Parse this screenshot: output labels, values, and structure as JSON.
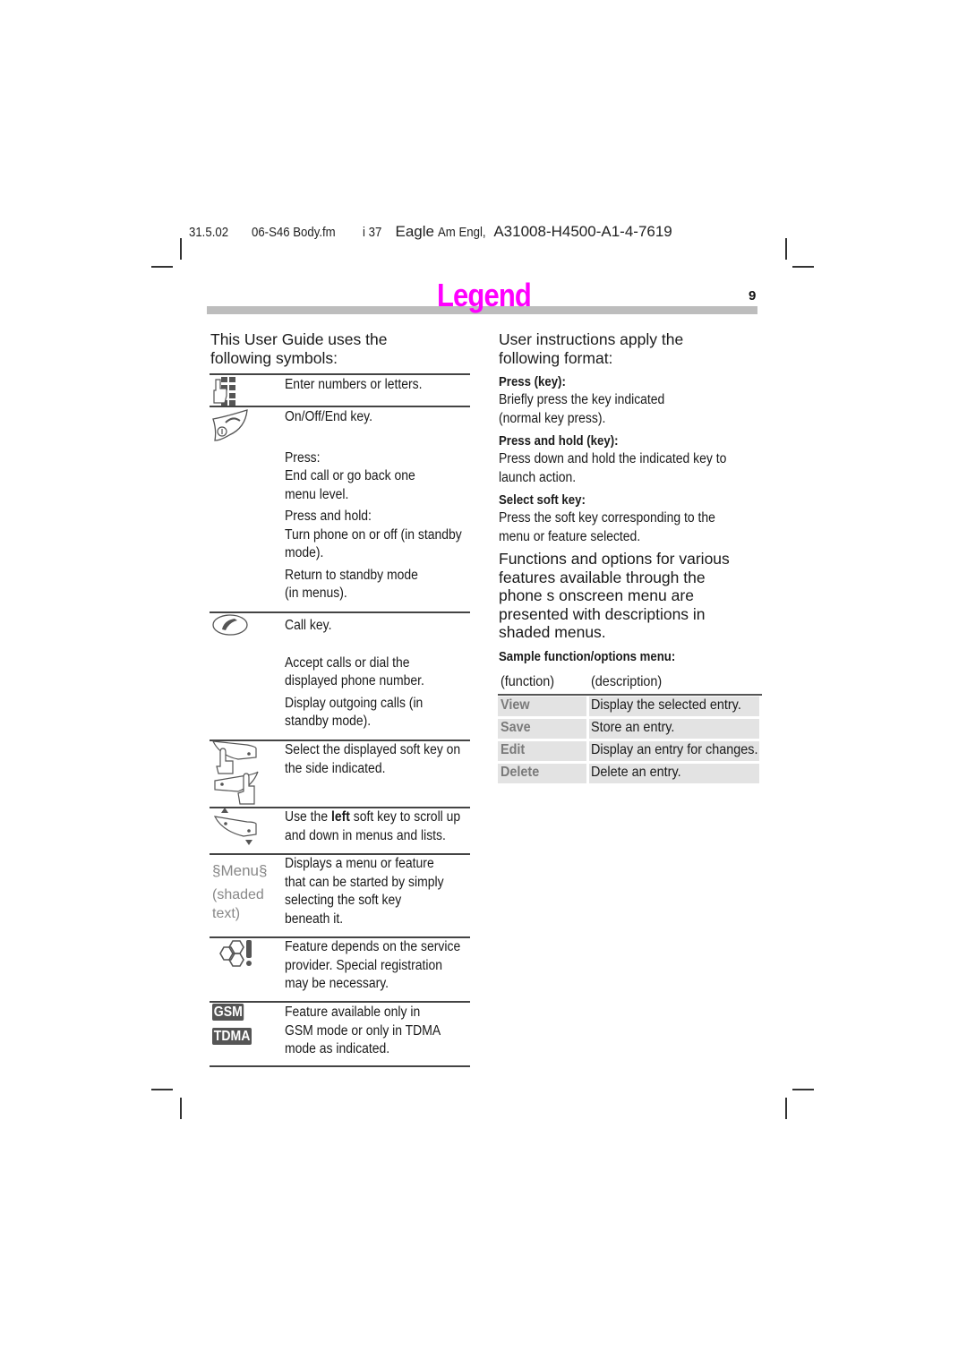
{
  "header": {
    "date": "31.5.02",
    "file": "06-S46 Body.fm",
    "page_ref": "i 37",
    "doc_name": "Eagle",
    "doc_lang": "Am Engl,",
    "doc_code": "A31008-H4500-A1-4-7619"
  },
  "page": {
    "title": "Legend",
    "number": "9",
    "title_color": "#ff00ff"
  },
  "left": {
    "intro_line1": "This User Guide uses the",
    "intro_line2": "following symbols:",
    "symbols": [
      {
        "icon": "keypad-hand-icon",
        "lines": [
          "Enter numbers or letters."
        ]
      },
      {
        "icon": "on-off-end-key-icon",
        "lines": [
          "On/Off/End key.",
          "",
          "Press:",
          "End call or go back one",
          "menu level.",
          "Press and hold:",
          "Turn phone on or off (in standby",
          "mode).",
          "Return to standby mode",
          "(in menus)."
        ]
      },
      {
        "icon": "call-key-icon",
        "lines": [
          "Call key.",
          "",
          "Accept calls or dial the",
          "displayed phone number.",
          "Display outgoing calls (in",
          "standby mode)."
        ]
      },
      {
        "icon": "soft-key-hand-icon",
        "lines": [
          "Select the displayed soft key on",
          "the side indicated."
        ]
      },
      {
        "icon": "soft-key-scroll-icon",
        "lines_pre": "Use the ",
        "bold": "left",
        "lines_post": " soft key to scroll up",
        "line2": "and down in menus and lists."
      },
      {
        "icon": "menu-shaded-text",
        "label": "§Menu§",
        "label2": "(shaded",
        "label3": "text)",
        "lines": [
          "Displays a menu or feature",
          "that can be started by simply",
          "selecting the soft key",
          "beneath it."
        ]
      },
      {
        "icon": "service-provider-icon",
        "lines": [
          "Feature depends on the service",
          "provider. Special registration",
          "may be necessary."
        ]
      },
      {
        "icon": "gsm-tdma-badge",
        "badge1": "GSM",
        "badge2": "TDMA",
        "lines": [
          "Feature available only in",
          "GSM mode or only in TDMA",
          "mode as indicated."
        ]
      }
    ]
  },
  "right": {
    "intro_line1": "User instructions apply the",
    "intro_line2": "following format:",
    "formats": [
      {
        "heading": "Press (key):",
        "lines": [
          "Briefly press the key indicated",
          "(normal key press)."
        ]
      },
      {
        "heading": "Press and hold (key):",
        "lines": [
          "Press down and hold the indicated key to",
          "launch action."
        ]
      },
      {
        "heading": "Select soft key:",
        "lines": [
          "Press the soft key corresponding to the",
          "menu or feature selected."
        ]
      }
    ],
    "functions_para": [
      "Functions and options for various",
      "features available through the",
      "phone s onscreen menu are",
      "presented with descriptions in",
      "shaded menus."
    ],
    "sample_heading": "Sample function/options menu:",
    "menu": {
      "col_function": "(function)",
      "col_description": "(description)",
      "rows": [
        {
          "function": "View",
          "description": "Display the selected entry."
        },
        {
          "function": "Save",
          "description": "Store an entry."
        },
        {
          "function": "Edit",
          "description": "Display an entry for changes."
        },
        {
          "function": "Delete",
          "description": "Delete an entry."
        }
      ]
    }
  }
}
